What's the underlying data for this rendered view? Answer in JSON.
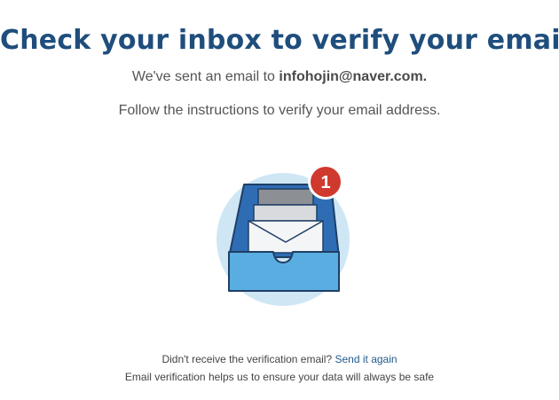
{
  "heading": "Check your inbox to verify your email",
  "message": {
    "sent_prefix": "We've sent an email to",
    "email": "infohojin@naver.com.",
    "instructions": "Follow the instructions to verify your email address."
  },
  "illustration": {
    "icon": "inbox-tray-icon",
    "badge_count": "1",
    "colors": {
      "circle": "#cfe6f5",
      "tray_back": "#2e6db4",
      "tray_front": "#5aade0",
      "outline": "#1f3f66",
      "badge": "#d0392e"
    }
  },
  "footer": {
    "question": "Didn't receive the verification email?",
    "resend_label": "Send it again",
    "safety_note": "Email verification helps us to ensure your data will always be safe"
  },
  "colors": {
    "heading": "#1f4e7d",
    "link": "#1f5a8c",
    "body_text": "#555555"
  }
}
